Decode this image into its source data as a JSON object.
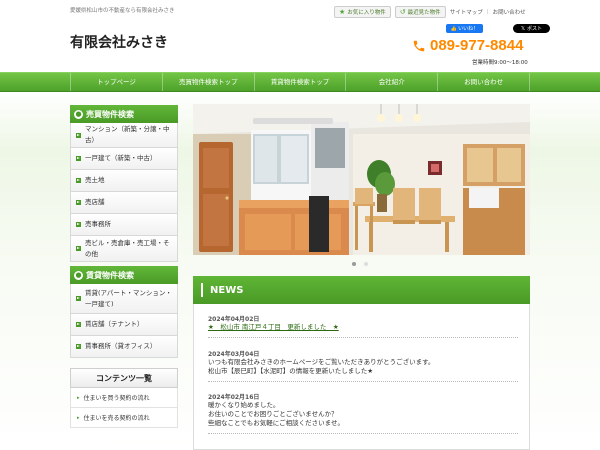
{
  "header": {
    "tagline": "愛媛県松山市の不動産なら有限会社みさき",
    "logo": "有限会社みさき",
    "favorites_label": "お気に入り物件",
    "recent_label": "最近見た物件",
    "sitemap_label": "サイトマップ",
    "contact_label": "お問い合わせ",
    "fb_like": "いいね！",
    "x_post": "ポスト",
    "phone": "089-977-8844",
    "hours": "営業時間9:00～18:00"
  },
  "nav": {
    "items": [
      {
        "label": "トップページ"
      },
      {
        "label": "売買物件検索トップ"
      },
      {
        "label": "賃貸物件検索トップ"
      },
      {
        "label": "会社紹介"
      },
      {
        "label": "お問い合わせ"
      }
    ]
  },
  "sidebar": {
    "sale_title": "売買物件検索",
    "sale_items": [
      {
        "label": "マンション（新築・分譲・中古）"
      },
      {
        "label": "一戸建て（新築・中古）"
      },
      {
        "label": "売土地"
      },
      {
        "label": "売店舗"
      },
      {
        "label": "売事務所"
      },
      {
        "label": "売ビル・売倉庫・売工場・その他"
      }
    ],
    "rent_title": "賃貸物件検索",
    "rent_items": [
      {
        "label": "賃貸(アパート・マンション・一戸建て)"
      },
      {
        "label": "賃店舗（テナント）"
      },
      {
        "label": "賃事務所（貸オフィス）"
      }
    ],
    "contents_title": "コンテンツ一覧",
    "contents_items": [
      {
        "label": "住まいを買う契約の流れ"
      },
      {
        "label": "住まいを売る契約の流れ"
      }
    ]
  },
  "news": {
    "title": "NEWS",
    "entries": [
      {
        "date": "2024年04月02日",
        "lines": [
          "★　松山市 南江戸４丁目　更新しました　★"
        ]
      },
      {
        "date": "2024年03月04日",
        "lines": [
          "いつも有限会社みさきのホームページをご覧いただきありがとうございます。",
          "松山市【辰巳町】【水泥町】の情報を更新いたしました★"
        ]
      },
      {
        "date": "2024年02月16日",
        "lines": [
          "暖かくなり始めました。",
          "お住いのことでお困りごとございませんか？",
          "些細なことでもお気軽にご相談くださいませ。"
        ]
      }
    ]
  },
  "colors": {
    "brand_green": "#4e9f2a",
    "phone_orange": "#ff8a00"
  }
}
